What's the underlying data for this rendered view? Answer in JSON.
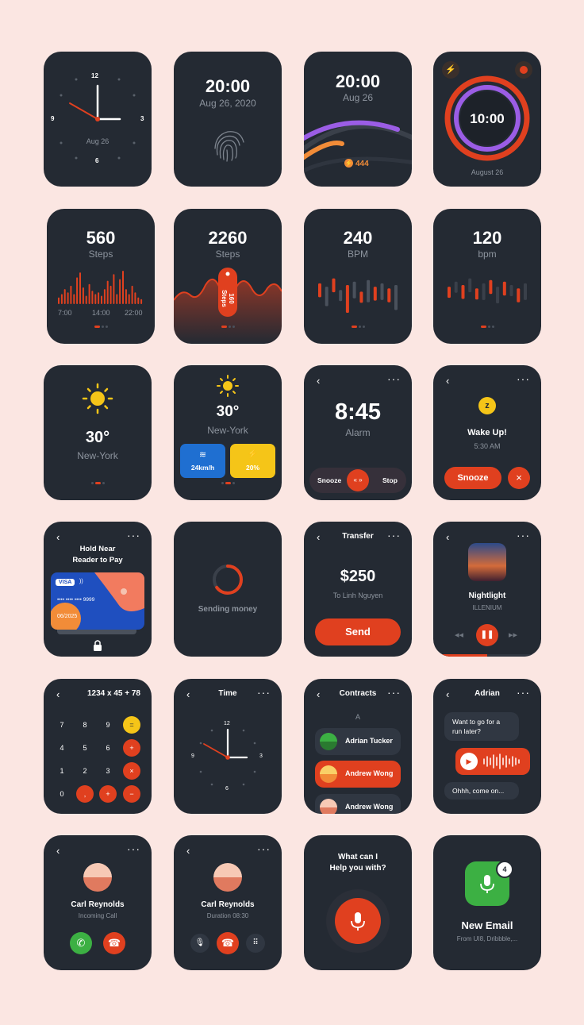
{
  "colors": {
    "background": "#fbe6e2",
    "card": "#242a33",
    "card_inner": "#303742",
    "accent": "#e0401f",
    "purple": "#9b5de5",
    "orange": "#f28c38",
    "yellow": "#f5c518",
    "blue": "#1f6fd1",
    "green": "#3cb043",
    "muted_text": "#8d949e"
  },
  "analog_clock": {
    "numerals": [
      "12",
      "3",
      "6",
      "9"
    ],
    "date": "Aug 26"
  },
  "lock": {
    "time": "20:00",
    "date": "Aug 26, 2020",
    "icon": "fingerprint-icon"
  },
  "arc_clock": {
    "time": "20:00",
    "date": "Aug 26",
    "energy": "444",
    "icon": "bolt-icon"
  },
  "ring_clock": {
    "time": "10:00",
    "date": "August 26",
    "icons": [
      "bolt-icon",
      "record-icon"
    ]
  },
  "steps_chart": {
    "value": "560",
    "unit": "Steps",
    "x_labels": [
      "7:00",
      "14:00",
      "22:00"
    ],
    "bars": [
      0.2,
      0.3,
      0.45,
      0.35,
      0.55,
      0.3,
      0.8,
      0.95,
      0.5,
      0.25,
      0.6,
      0.4,
      0.3,
      0.35,
      0.25,
      0.45,
      0.7,
      0.55,
      0.9,
      0.3,
      0.75,
      1.0,
      0.45,
      0.3,
      0.55,
      0.35,
      0.2,
      0.15
    ]
  },
  "steps_wave": {
    "value": "2260",
    "unit": "Steps",
    "badge": "160 Steps"
  },
  "bpm_chart": {
    "value": "240",
    "unit": "BPM",
    "candles": [
      [
        0.55,
        0.25
      ],
      [
        0.45,
        0.35
      ],
      [
        0.7,
        0.25
      ],
      [
        0.35,
        0.2
      ],
      [
        0.5,
        0.5
      ],
      [
        0.6,
        0.3
      ],
      [
        0.3,
        0.2
      ],
      [
        0.65,
        0.4
      ],
      [
        0.45,
        0.25
      ],
      [
        0.55,
        0.3
      ],
      [
        0.4,
        0.25
      ],
      [
        0.5,
        0.45
      ]
    ]
  },
  "bpm_chart2": {
    "value": "120",
    "unit": "bpm",
    "candles": [
      [
        0.45,
        0.2
      ],
      [
        0.6,
        0.2
      ],
      [
        0.5,
        0.25
      ],
      [
        0.7,
        0.25
      ],
      [
        0.4,
        0.2
      ],
      [
        0.55,
        0.3
      ],
      [
        0.65,
        0.25
      ],
      [
        0.45,
        0.3
      ],
      [
        0.6,
        0.25
      ],
      [
        0.5,
        0.2
      ],
      [
        0.4,
        0.25
      ],
      [
        0.55,
        0.3
      ]
    ]
  },
  "weather1": {
    "temp": "30°",
    "city": "New-York",
    "icon": "sun-icon"
  },
  "weather2": {
    "temp": "30°",
    "city": "New-York",
    "icon": "sun-icon",
    "wind": "24km/h",
    "wind_icon": "wind-icon",
    "chance": "20%",
    "chance_icon": "lightning-icon"
  },
  "alarm": {
    "time": "8:45",
    "label": "Alarm",
    "snooze": "Snooze",
    "stop": "Stop",
    "slider": "« »"
  },
  "wake": {
    "title": "Wake Up!",
    "time": "5:30 AM",
    "snooze": "Snooze",
    "close": "×",
    "icon": "alarm-clock-icon"
  },
  "pay": {
    "title_line1": "Hold Near",
    "title_line2": "Reader to Pay",
    "brand": "VISA",
    "number": "•••• •••• •••• 9999",
    "expiry": "06/2025",
    "icon": "lock-icon"
  },
  "sending": {
    "label": "Sending money",
    "progress": 0.35
  },
  "transfer": {
    "title": "Transfer",
    "amount": "$250",
    "recipient": "To Linh Nguyen",
    "button": "Send"
  },
  "music": {
    "title": "Nightlight",
    "artist": "ILLENIUM",
    "progress": 0.5,
    "icons": [
      "rewind-icon",
      "pause-icon",
      "fast-forward-icon"
    ]
  },
  "calculator": {
    "expression": "1234 x 45 + 78",
    "keys": [
      [
        "7",
        "8",
        "9",
        "="
      ],
      [
        "4",
        "5",
        "6",
        "+"
      ],
      [
        "1",
        "2",
        "3",
        "×"
      ],
      [
        "0",
        ",",
        "+",
        "−"
      ]
    ]
  },
  "time_screen": {
    "title": "Time",
    "numerals": [
      "12",
      "3",
      "6",
      "9"
    ]
  },
  "contacts": {
    "title": "Contracts",
    "section": "A",
    "items": [
      "Adrian Tucker",
      "Andrew Wong",
      "Andrew Wong"
    ]
  },
  "chat": {
    "title": "Adrian",
    "message1": "Want to go for a run later?",
    "message2": "Ohhh, come on...",
    "icons": [
      "play-icon"
    ]
  },
  "incoming_call": {
    "name": "Carl Reynolds",
    "status": "Incoming Call",
    "icons": [
      "accept-call-icon",
      "decline-call-icon"
    ]
  },
  "active_call": {
    "name": "Carl Reynolds",
    "duration": "Duration 08:30",
    "icons": [
      "mic-icon",
      "end-call-icon",
      "keypad-icon"
    ]
  },
  "assistant": {
    "line1": "What can I",
    "line2": "Help you with?",
    "icon": "mic-icon"
  },
  "email": {
    "title": "New Email",
    "from": "From UI8, Dribbble,...",
    "badge": "4",
    "icon": "mic-icon"
  }
}
